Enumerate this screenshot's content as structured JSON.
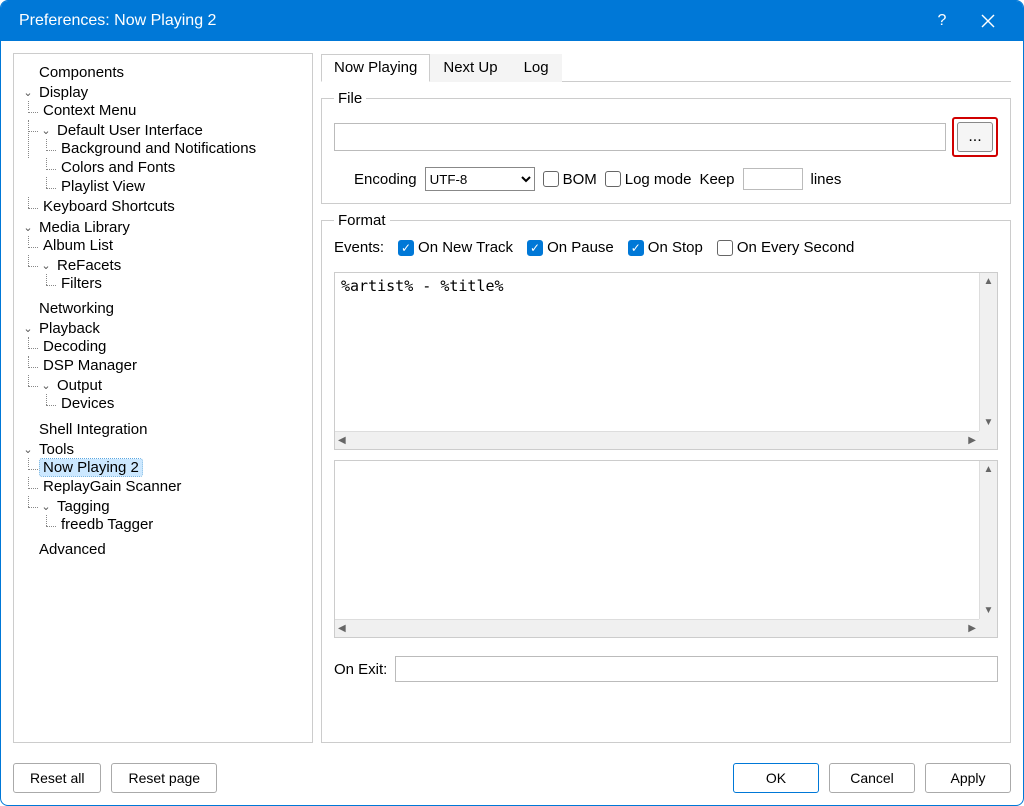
{
  "window": {
    "title": "Preferences: Now Playing 2"
  },
  "tree": {
    "components": "Components",
    "display": "Display",
    "context_menu": "Context Menu",
    "default_ui": "Default User Interface",
    "bg_notif": "Background and Notifications",
    "colors_fonts": "Colors and Fonts",
    "playlist_view": "Playlist View",
    "keyboard": "Keyboard Shortcuts",
    "media_library": "Media Library",
    "album_list": "Album List",
    "refacets": "ReFacets",
    "filters": "Filters",
    "networking": "Networking",
    "playback": "Playback",
    "decoding": "Decoding",
    "dsp": "DSP Manager",
    "output": "Output",
    "devices": "Devices",
    "shell": "Shell Integration",
    "tools": "Tools",
    "now_playing_2": "Now Playing 2",
    "replaygain": "ReplayGain Scanner",
    "tagging": "Tagging",
    "freedb": "freedb Tagger",
    "advanced": "Advanced"
  },
  "tabs": {
    "now_playing": "Now Playing",
    "next_up": "Next Up",
    "log": "Log"
  },
  "file": {
    "legend": "File",
    "path": "",
    "browse": "...",
    "encoding_label": "Encoding",
    "encoding_value": "UTF-8",
    "bom": "BOM",
    "log_mode": "Log mode",
    "keep": "Keep",
    "keep_value": "",
    "lines": "lines"
  },
  "format": {
    "legend": "Format",
    "events_label": "Events:",
    "on_new_track": "On New Track",
    "on_pause": "On Pause",
    "on_stop": "On Stop",
    "on_every_second": "On Every Second",
    "template": "%artist% - %title%",
    "preview": "",
    "on_exit_label": "On Exit:",
    "on_exit_value": ""
  },
  "buttons": {
    "reset_all": "Reset all",
    "reset_page": "Reset page",
    "ok": "OK",
    "cancel": "Cancel",
    "apply": "Apply"
  },
  "checkboxes": {
    "bom": false,
    "log_mode": false,
    "on_new_track": true,
    "on_pause": true,
    "on_stop": true,
    "on_every_second": false
  }
}
